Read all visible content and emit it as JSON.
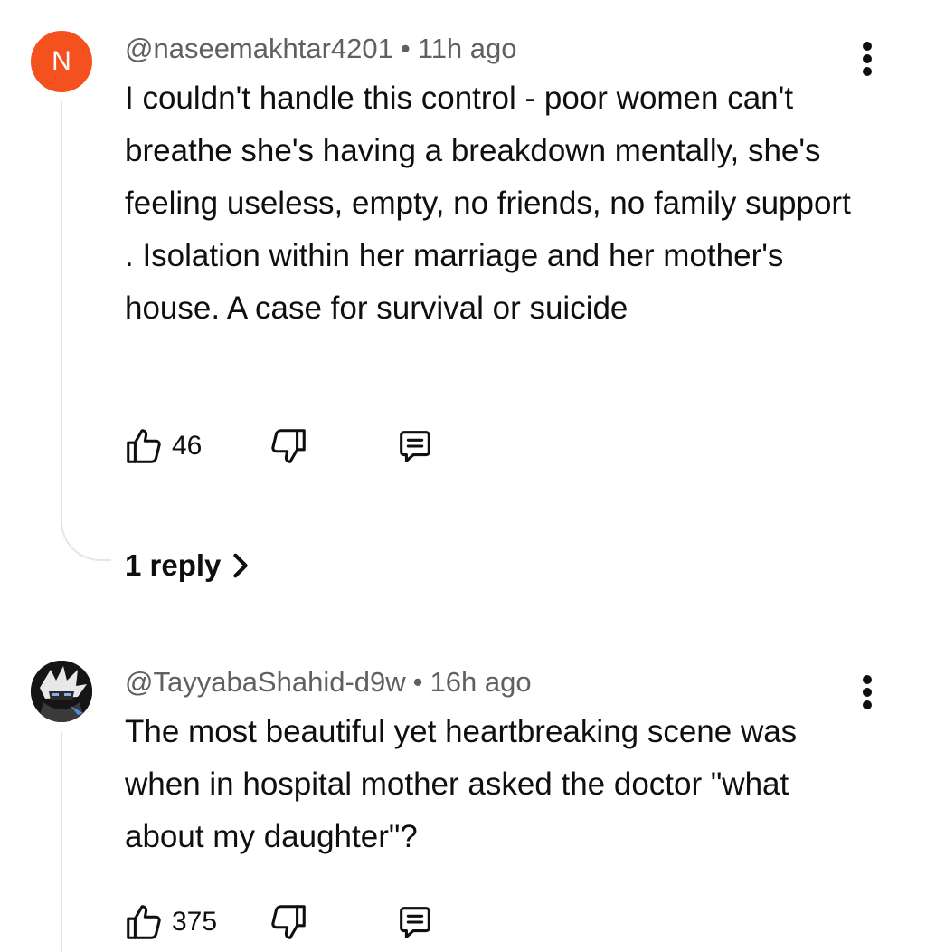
{
  "comments": [
    {
      "avatar_letter": "N",
      "avatar_color": "#f4511e",
      "author": "@naseemakhtar4201",
      "separator": "•",
      "time": "11h ago",
      "text": "I couldn't handle this control - poor women can't breathe she's having a breakdown mentally, she's feeling useless, empty, no friends, no family support . Isolation within her marriage and her mother's house. A case for survival or suicide",
      "likes": "46",
      "replies_label": "1 reply",
      "icons": [
        "like-icon",
        "dislike-icon",
        "reply-icon",
        "more-vert-icon",
        "chevron-right-icon"
      ]
    },
    {
      "avatar_letter": "",
      "author": "@TayyabaShahid-d9w",
      "separator": "•",
      "time": "16h ago",
      "text": "The most beautiful yet heartbreaking scene was when in hospital mother asked the doctor \"what about my daughter\"?",
      "likes": "375",
      "icons": [
        "like-icon",
        "dislike-icon",
        "reply-icon",
        "more-vert-icon"
      ]
    }
  ]
}
